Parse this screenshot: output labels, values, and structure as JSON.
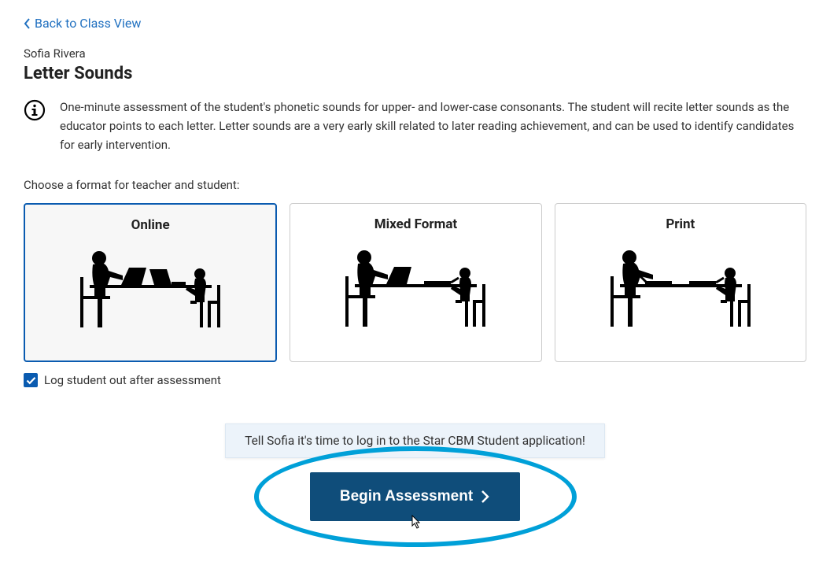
{
  "back_link": "Back to Class View",
  "student_name": "Sofia Rivera",
  "page_title": "Letter Sounds",
  "info_text": "One-minute assessment of the student's phonetic sounds for upper- and lower-case consonants. The student will recite letter sounds as the educator points to each letter. Letter sounds are a very early skill related to later reading achievement, and can be used to identify candidates for early intervention.",
  "choose_label": "Choose a format for teacher and student:",
  "formats": {
    "online": {
      "title": "Online"
    },
    "mixed": {
      "title": "Mixed Format"
    },
    "print": {
      "title": "Print"
    }
  },
  "logout_checkbox": {
    "label": "Log student out after assessment",
    "checked": true
  },
  "tooltip": "Tell Sofia it's time to log in to the Star CBM Student application!",
  "begin_button": "Begin Assessment"
}
